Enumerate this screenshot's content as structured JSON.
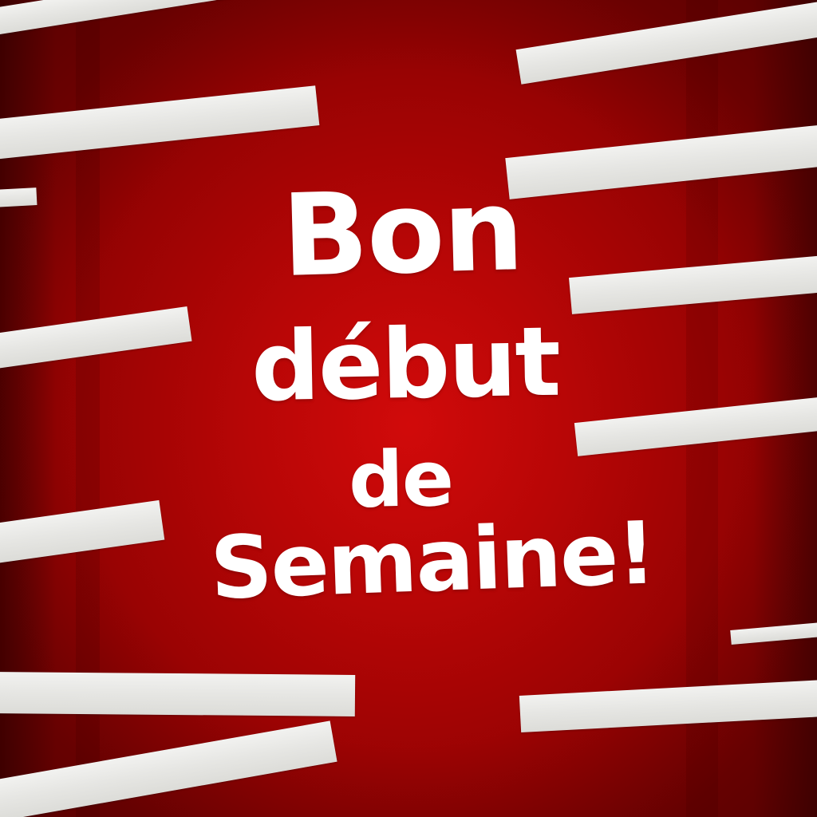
{
  "greeting": {
    "line1": "Bon",
    "line2": "début",
    "line3": "de",
    "line4": "Semaine!"
  },
  "colors": {
    "background": "#b80606",
    "tape": "#eeeeea",
    "text": "#ffffff"
  }
}
